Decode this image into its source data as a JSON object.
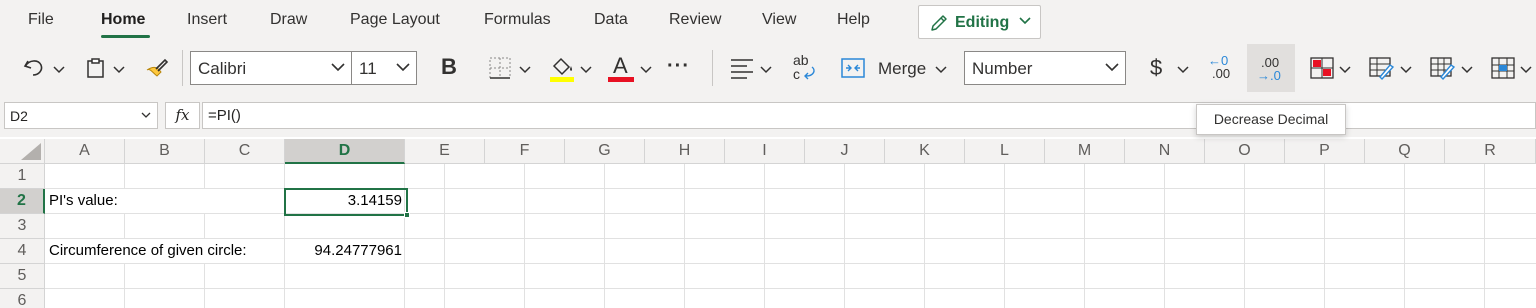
{
  "menu": {
    "tabs": [
      "File",
      "Home",
      "Insert",
      "Draw",
      "Page Layout",
      "Formulas",
      "Data",
      "Review",
      "View",
      "Help"
    ],
    "active_tab": "Home",
    "editing_label": "Editing"
  },
  "ribbon": {
    "font_name": "Calibri",
    "font_size": "11",
    "bold_label": "B",
    "font_color_label": "A",
    "more_label": "···",
    "merge_label": "Merge",
    "number_format": "Number",
    "currency_label": "$",
    "increase_decimal": {
      "top": "←0",
      "bottom": ".00"
    },
    "decrease_decimal": {
      "top": ".00",
      "bottom": "→.0"
    },
    "wrap_label": {
      "top": "ab",
      "bottom": "c"
    },
    "colors": {
      "highlight": "#ffff00",
      "font_color": "#e81123",
      "accent": "#217346",
      "icon_blue": "#2b88d8"
    }
  },
  "formula_bar": {
    "name_box": "D2",
    "fx_label": "fx",
    "formula": "=PI()"
  },
  "tooltip": "Decrease Decimal",
  "sheet": {
    "columns": [
      "A",
      "B",
      "C",
      "D",
      "E",
      "F",
      "G",
      "H",
      "I",
      "J",
      "K",
      "L",
      "M",
      "N",
      "O",
      "P",
      "Q",
      "R"
    ],
    "rows": [
      "1",
      "2",
      "3",
      "4",
      "5",
      "6"
    ],
    "selected_column": "D",
    "selected_row": "2",
    "cells": {
      "A2": "PI's value:",
      "D2": "3.14159",
      "A4": "Circumference of given circle:",
      "D4": "94.24777961"
    }
  }
}
